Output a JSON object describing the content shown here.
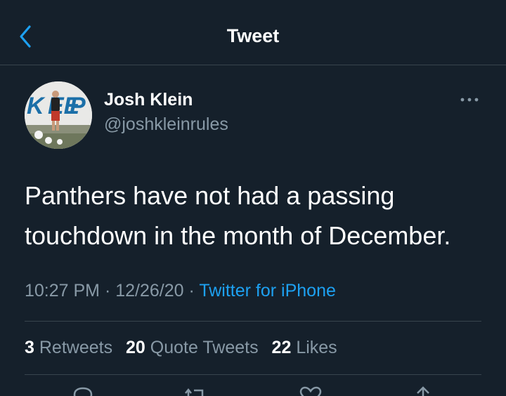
{
  "header": {
    "title": "Tweet",
    "back_icon": "chevron-left-icon",
    "accent_color": "#1da1f2"
  },
  "author": {
    "name": "Josh Klein",
    "handle": "@joshkleinrules",
    "avatar_text": "KEEP"
  },
  "tweet": {
    "text": "Panthers have not had a passing touchdown in the month of December.",
    "time": "10:27 PM",
    "date": "12/26/20",
    "source": "Twitter for iPhone"
  },
  "stats": {
    "retweets_count": "3",
    "retweets_label": "Retweets",
    "quotes_count": "20",
    "quotes_label": "Quote Tweets",
    "likes_count": "22",
    "likes_label": "Likes"
  },
  "actions": [
    "reply-icon",
    "retweet-icon",
    "like-icon",
    "share-icon"
  ],
  "colors": {
    "background": "#15202b",
    "divider": "#38444d",
    "secondary_text": "#8899a6",
    "primary_text": "#ffffff"
  }
}
